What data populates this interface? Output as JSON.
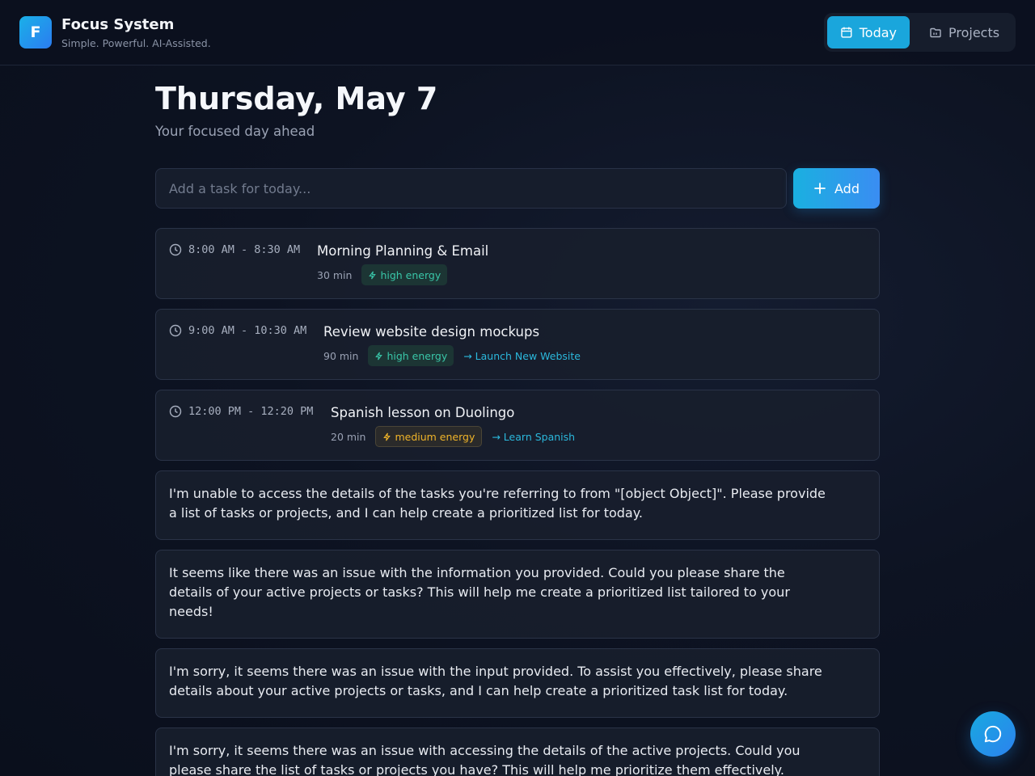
{
  "app": {
    "logo_letter": "F",
    "title": "Focus System",
    "subtitle": "Simple. Powerful. AI-Assisted."
  },
  "nav": {
    "today_label": "Today",
    "projects_label": "Projects"
  },
  "page": {
    "date_heading": "Thursday, May 7",
    "subheading": "Your focused day ahead"
  },
  "add_task": {
    "placeholder": "Add a task for today...",
    "button_label": "Add"
  },
  "tasks": [
    {
      "time": "8:00 AM - 8:30 AM",
      "title": "Morning Planning & Email",
      "duration": "30 min",
      "energy": "high energy",
      "project": ""
    },
    {
      "time": "9:00 AM - 10:30 AM",
      "title": "Review website design mockups",
      "duration": "90 min",
      "energy": "high energy",
      "project": "→ Launch New Website"
    },
    {
      "time": "12:00 PM - 12:20 PM",
      "title": "Spanish lesson on Duolingo",
      "duration": "20 min",
      "energy": "medium energy",
      "project": "→ Learn Spanish"
    }
  ],
  "messages": [
    "I'm unable to access the details of the tasks you're referring to from \"[object Object]\". Please provide a list of tasks or projects, and I can help create a prioritized list for today.",
    "It seems like there was an issue with the information you provided. Could you please share the details of your active projects or tasks? This will help me create a prioritized list tailored to your needs!",
    "I'm sorry, it seems there was an issue with the input provided. To assist you effectively, please share details about your active projects or tasks, and I can help create a prioritized task list for today.",
    "I'm sorry, it seems there was an issue with accessing the details of the active projects. Could you please share the list of tasks or projects you have? This will help me prioritize them effectively."
  ],
  "colors": {
    "accent": "#1aa6dc",
    "high_energy": "#39c6a8",
    "medium_energy": "#f0b429",
    "project_link": "#2bb8dc"
  },
  "icons": {
    "nav_today": "calendar-icon",
    "nav_projects": "folder-icon",
    "task_time": "clock-icon",
    "energy": "zap-icon",
    "add": "plus-icon",
    "chat": "chat-bubble-icon"
  }
}
